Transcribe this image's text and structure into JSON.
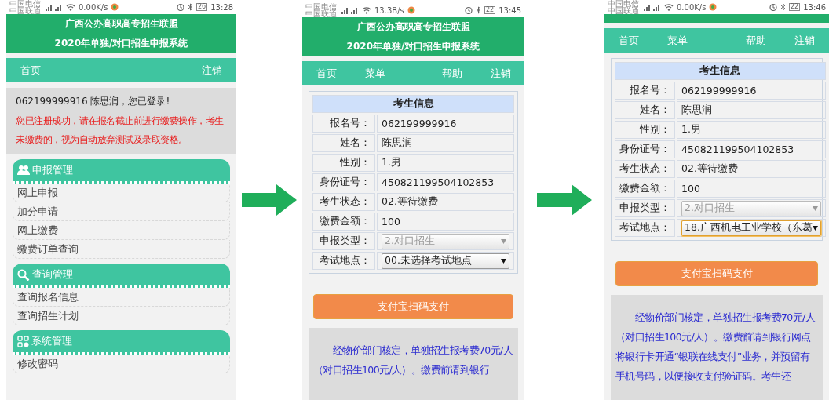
{
  "screens": [
    {
      "status_bar": {
        "carriers": [
          "中国电信",
          "中国联通"
        ],
        "speed": "0.00K/s",
        "battery": "26",
        "time": "13:28"
      },
      "header": {
        "lines": [
          "广西公办高职高专招生联盟",
          "2020年单独/对口招生申报系统"
        ]
      },
      "nav": {
        "left": [
          "首页"
        ],
        "right": [
          "注销"
        ]
      },
      "welcome": {
        "greeting": "062199999916 陈思润，您已登录!",
        "warning": "您已注册成功，请在报名截止前进行缴费操作，考生未缴费的，视为自动放弃测试及录取资格。"
      },
      "menu_groups": [
        {
          "title": "申报管理",
          "items": [
            "网上申报",
            "加分申请",
            "网上缴费",
            "缴费订单查询"
          ]
        },
        {
          "title": "查询管理",
          "items": [
            "查询报名信息",
            "查询招生计划"
          ]
        },
        {
          "title": "系统管理",
          "items": [
            "修改密码"
          ]
        }
      ]
    },
    {
      "status_bar": {
        "carriers": [
          "中国电信",
          "中国联通"
        ],
        "speed": "13.3B/s",
        "battery": "22",
        "time": "13:45"
      },
      "header": {
        "lines": [
          "广西公办高职高专招生联盟",
          "2020年单独/对口招生申报系统"
        ]
      },
      "nav": {
        "left": [
          "首页",
          "菜单"
        ],
        "right": [
          "帮助",
          "注销"
        ]
      },
      "info_table": {
        "title": "考生信息",
        "rows": [
          {
            "kind": "text",
            "label": "报名号：",
            "value": "062199999916"
          },
          {
            "kind": "text",
            "label": "姓名：",
            "value": "陈思润"
          },
          {
            "kind": "text",
            "label": "性别：",
            "value": "1.男"
          },
          {
            "kind": "text",
            "label": "身份证号：",
            "value": "450821199504102853"
          },
          {
            "kind": "text",
            "label": "考生状态：",
            "value": "02.等待缴费"
          },
          {
            "kind": "text",
            "label": "缴费金额：",
            "value": "100"
          },
          {
            "kind": "select",
            "label": "申报类型：",
            "value": "2.对口招生",
            "disabled": true,
            "focused": false
          },
          {
            "kind": "select",
            "label": "考试地点：",
            "value": "00.未选择考试地点",
            "disabled": false,
            "focused": false
          }
        ]
      },
      "pay_button": "支付宝扫码支付",
      "notice": "经物价部门核定，单独招生报考费70元/人（对口招生100元/人）。缴费前请到银行"
    },
    {
      "status_bar": {
        "carriers": [
          "中国电信",
          "中国联通"
        ],
        "speed": "0.00K/s",
        "battery": "22",
        "time": "13:46"
      },
      "nav": {
        "left": [
          "首页",
          "菜单"
        ],
        "right": [
          "帮助",
          "注销"
        ]
      },
      "info_table": {
        "title": "考生信息",
        "rows": [
          {
            "kind": "text",
            "label": "报名号：",
            "value": "062199999916"
          },
          {
            "kind": "text",
            "label": "姓名：",
            "value": "陈思润"
          },
          {
            "kind": "text",
            "label": "性别：",
            "value": "1.男"
          },
          {
            "kind": "text",
            "label": "身份证号：",
            "value": "450821199504102853"
          },
          {
            "kind": "text",
            "label": "考生状态：",
            "value": "02.等待缴费"
          },
          {
            "kind": "text",
            "label": "缴费金额：",
            "value": "100"
          },
          {
            "kind": "select",
            "label": "申报类型：",
            "value": "2.对口招生",
            "disabled": true,
            "focused": false
          },
          {
            "kind": "select",
            "label": "考试地点：",
            "value": "18.广西机电工业学校（东葛",
            "disabled": false,
            "focused": true
          }
        ]
      },
      "pay_button": "支付宝扫码支付",
      "notice": "经物价部门核定，单独招生报考费70元/人（对口招生100元/人）。缴费前请到银行网点将银行卡开通“银联在线支付”业务，并预留有手机号码，以便接收支付验证码。考生还"
    }
  ]
}
